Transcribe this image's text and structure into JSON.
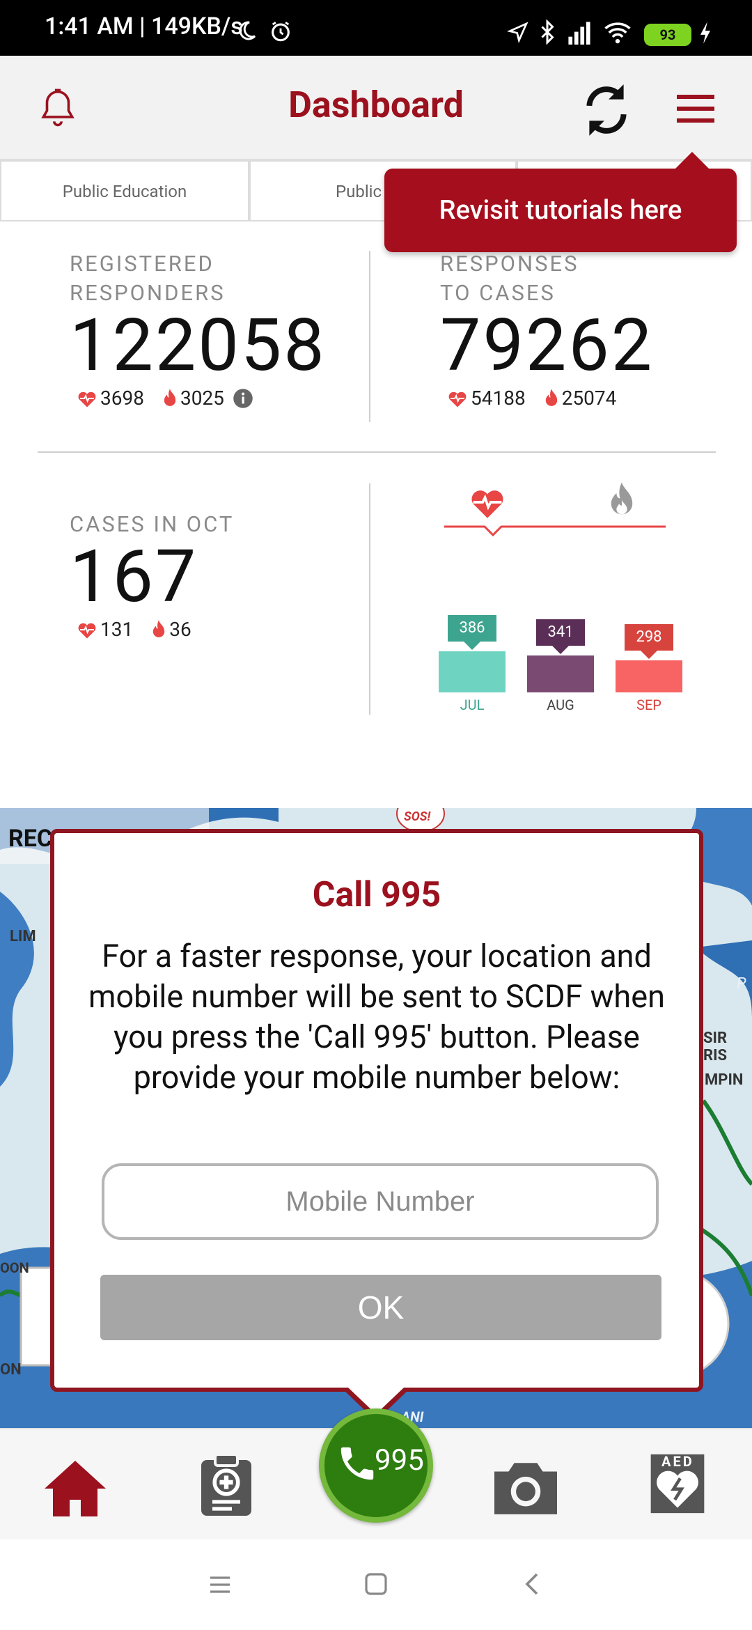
{
  "status_bar": {
    "time_text": "1:41 AM | 149KB/s",
    "battery": "93"
  },
  "header": {
    "title": "Dashboard"
  },
  "tabs": [
    {
      "label": "Public Education"
    },
    {
      "label": "Public"
    }
  ],
  "tooltip": {
    "text": "Revisit tutorials here"
  },
  "stats": {
    "registered": {
      "label_line1": "REGISTERED",
      "label_line2": "RESPONDERS",
      "value": "122058",
      "heart_count": "3698",
      "fire_count": "3025"
    },
    "responses": {
      "label_line1": "RESPONSES",
      "label_line2": "TO CASES",
      "value": "79262",
      "heart_count": "54188",
      "fire_count": "25074"
    },
    "cases": {
      "label": "CASES IN OCT",
      "value": "167",
      "heart_count": "131",
      "fire_count": "36"
    }
  },
  "chart_data": {
    "type": "bar",
    "categories": [
      "JUL",
      "AUG",
      "SEP"
    ],
    "values": [
      386,
      341,
      298
    ],
    "colors": [
      "#6fd3c2",
      "#7b4a72",
      "#f86464"
    ],
    "tag_colors": [
      "#3da58f",
      "#5a2e56",
      "#d7443e"
    ],
    "label_colors": [
      "#3da58f",
      "#444444",
      "#d7443e"
    ],
    "title": "",
    "xlabel": "",
    "ylabel": ""
  },
  "map": {
    "sos_label": "SOS!",
    "fragments": [
      "REC",
      "LIM",
      "P",
      "SIR RIS",
      "MPIN",
      "OON",
      "ON",
      "ANI"
    ]
  },
  "modal": {
    "title": "Call 995",
    "body": "For a faster response, your location and mobile number will be sent to SCDF when you press the 'Call 995' button. Please provide your mobile number below:",
    "input_placeholder": "Mobile Number",
    "input_value": "",
    "ok_label": "OK"
  },
  "bottom_nav": {
    "call_label": "995",
    "aed_label": "AED"
  },
  "theme": {
    "brand_red": "#9b111e",
    "call_green": "#2e7d0f"
  }
}
